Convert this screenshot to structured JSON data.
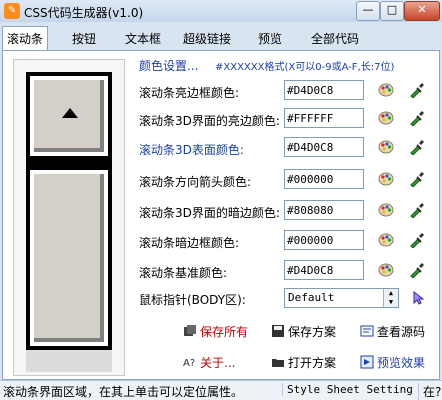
{
  "window": {
    "title": "CSS代码生成器(v1.0)",
    "minimize_glyph": "—",
    "maximize_glyph": "□",
    "close_glyph": "✕"
  },
  "tabs": [
    "滚动条",
    "按钮",
    "文本框",
    "超级链接",
    "预览",
    "全部代码"
  ],
  "header": {
    "label": "颜色设置...",
    "hint": "#XXXXXX格式(X可以0-9或A-F,长:7位)"
  },
  "rows": [
    {
      "label": "滚动条亮边框颜色:",
      "value": "#D4D0C8",
      "highlight": false
    },
    {
      "label": "滚动条3D界面的亮边颜色:",
      "value": "#FFFFFF",
      "highlight": false
    },
    {
      "label": "滚动条3D表面颜色:",
      "value": "#D4D0C8",
      "highlight": true
    },
    {
      "label": "滚动条方向箭头颜色:",
      "value": "#000000",
      "highlight": false
    },
    {
      "label": "滚动条3D界面的暗边颜色:",
      "value": "#808080",
      "highlight": false
    },
    {
      "label": "滚动条暗边框颜色:",
      "value": "#000000",
      "highlight": false
    },
    {
      "label": "滚动条基准颜色:",
      "value": "#D4D0C8",
      "highlight": false
    }
  ],
  "cursor": {
    "label": "鼠标指针(BODY区):",
    "value": "Default"
  },
  "actions": {
    "save_all": "保存所有",
    "save_scheme": "保存方案",
    "view_source": "查看源码",
    "about": "关于...",
    "open_scheme": "打开方案",
    "preview_effect": "预览效果"
  },
  "status": {
    "left": "滚动条界面区域，在其上单击可以定位属性。",
    "mid": "Style Sheet Setting",
    "right": "在?"
  },
  "colors": {
    "accent_blue": "#1a3fb0",
    "alert_red": "#c00000"
  }
}
